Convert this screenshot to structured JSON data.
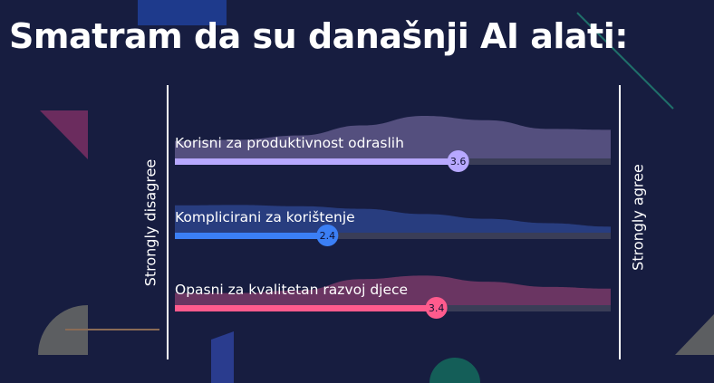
{
  "title": "Smatram da su današnji AI alati:",
  "scale": {
    "left_label": "Strongly disagree",
    "right_label": "Strongly agree"
  },
  "chart_data": {
    "type": "bar",
    "title": "Smatram da su današnji AI alati:",
    "xlim": [
      1,
      5
    ],
    "x_min_label": "Strongly disagree",
    "x_max_label": "Strongly agree",
    "categories": [
      "Korisni za produktivnost odraslih",
      "Komplicirani za korištenje",
      "Opasni za kvalitetan razvoj djece"
    ],
    "values": [
      3.6,
      2.4,
      3.4
    ],
    "value_labels": [
      "3.6",
      "2.4",
      "3.4"
    ],
    "colors": [
      "#b7a8ff",
      "#3b7ff5",
      "#ff5b8d"
    ],
    "distribution_colors": [
      "#544f7e",
      "#283d7f",
      "#6a3562"
    ],
    "distributions": [
      [
        0.42,
        0.45,
        0.55,
        0.78,
        1.0,
        0.9,
        0.7,
        0.68
      ],
      [
        0.65,
        0.66,
        0.63,
        0.57,
        0.45,
        0.34,
        0.24,
        0.16
      ],
      [
        0.3,
        0.3,
        0.36,
        0.62,
        0.7,
        0.56,
        0.44,
        0.4
      ]
    ]
  }
}
